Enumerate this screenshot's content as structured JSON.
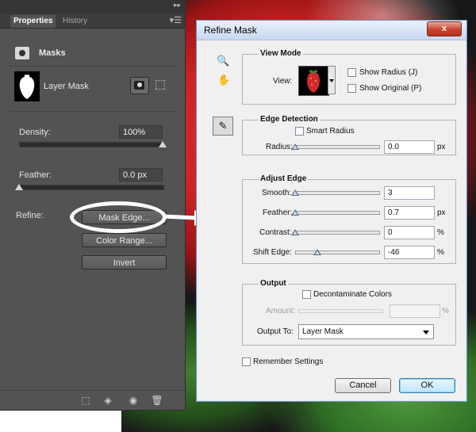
{
  "properties_panel": {
    "tabs": [
      {
        "label": "Properties",
        "active": true
      },
      {
        "label": "History",
        "active": false
      }
    ],
    "menu_icon": "panel-menu-icon",
    "section_title": "Masks",
    "layer_label": "Layer Mask",
    "density": {
      "label": "Density:",
      "value": "100%",
      "fraction": 1.0
    },
    "feather": {
      "label": "Feather:",
      "value": "0.0 px",
      "fraction": 0.0
    },
    "refine_label": "Refine:",
    "buttons": {
      "mask_edge": "Mask Edge...",
      "color_range": "Color Range...",
      "invert": "Invert"
    },
    "bottom_icons": [
      "load-selection-icon",
      "apply-mask-icon",
      "visibility-eye-icon",
      "trash-icon"
    ]
  },
  "dialog": {
    "title": "Refine Mask",
    "close_label": "x",
    "tools": [
      "zoom-tool-icon",
      "hand-tool-icon",
      "refine-radius-brush-icon"
    ],
    "view_mode": {
      "title": "View Mode",
      "view_label": "View:",
      "show_radius": {
        "label": "Show Radius (J)",
        "checked": false
      },
      "show_original": {
        "label": "Show Original (P)",
        "checked": false
      }
    },
    "edge_detection": {
      "title": "Edge Detection",
      "smart_radius": {
        "label": "Smart Radius",
        "checked": false
      },
      "radius": {
        "label": "Radius:",
        "value": "0.0",
        "unit": "px",
        "fraction": 0.0
      }
    },
    "adjust_edge": {
      "title": "Adjust Edge",
      "smooth": {
        "label": "Smooth:",
        "value": "3",
        "unit": "",
        "fraction": 0.0
      },
      "feather": {
        "label": "Feather:",
        "value": "0.7",
        "unit": "px",
        "fraction": 0.0
      },
      "contrast": {
        "label": "Contrast:",
        "value": "0",
        "unit": "%",
        "fraction": 0.0
      },
      "shift_edge": {
        "label": "Shift Edge:",
        "value": "-46",
        "unit": "%",
        "fraction": 0.27
      }
    },
    "output": {
      "title": "Output",
      "decontaminate": {
        "label": "Decontaminate Colors",
        "checked": false
      },
      "amount": {
        "label": "Amount:",
        "value": "",
        "unit": "%"
      },
      "output_to_label": "Output To:",
      "output_to_value": "Layer Mask"
    },
    "remember_settings": {
      "label": "Remember Settings",
      "checked": false
    },
    "buttons": {
      "cancel": "Cancel",
      "ok": "OK"
    }
  },
  "colors": {
    "panel_bg": "#535353",
    "dialog_bg": "#f0f0f0",
    "ok_accent": "#3c7fb1"
  }
}
